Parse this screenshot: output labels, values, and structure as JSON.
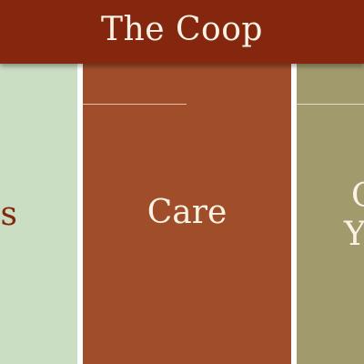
{
  "header": {
    "title": "The Coop"
  },
  "panels": [
    {
      "label": "ls"
    },
    {
      "label": "Care"
    },
    {
      "label_line1": "C",
      "label_line2": "Yo"
    }
  ],
  "colors": {
    "header_bg": "#85260f",
    "header_text": "#fbf3e6",
    "panel_left_bg": "#cadec3",
    "panel_center_bg": "#a04e29",
    "panel_right_bg": "#a19a6c",
    "panel_left_text": "#85260f",
    "panel_text_light": "#fbf3e6"
  }
}
